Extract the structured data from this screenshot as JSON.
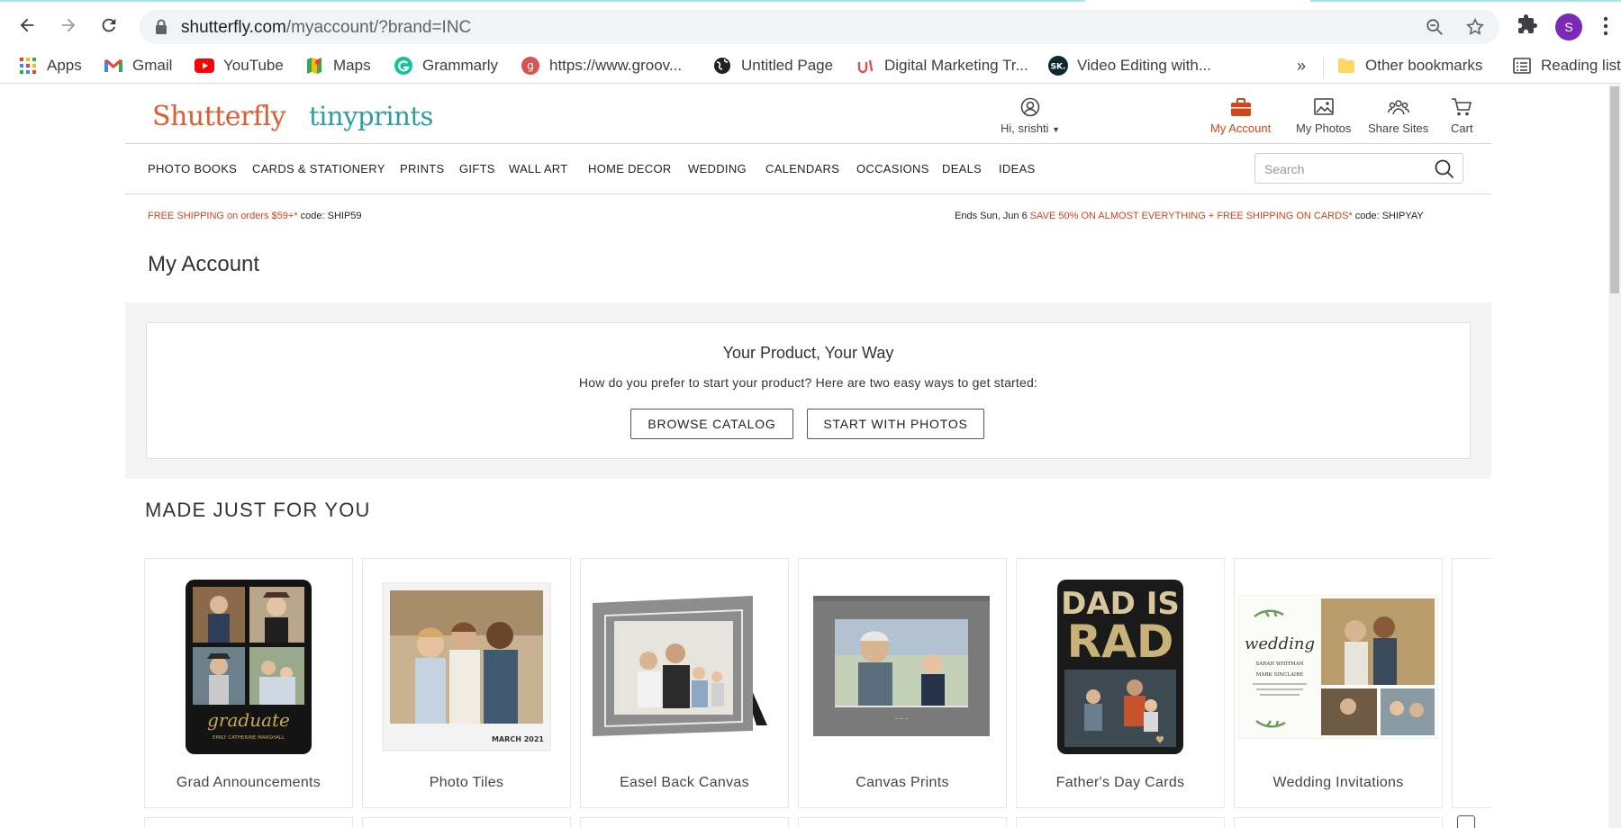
{
  "browser": {
    "url_host": "shutterfly.com",
    "url_path": "/myaccount/?brand=INC",
    "profile_initial": "S",
    "bookmarks": [
      {
        "label": "Apps",
        "icon": "apps-grid-icon"
      },
      {
        "label": "Gmail",
        "icon": "gmail-icon"
      },
      {
        "label": "YouTube",
        "icon": "youtube-icon"
      },
      {
        "label": "Maps",
        "icon": "maps-icon"
      },
      {
        "label": "Grammarly",
        "icon": "grammarly-icon"
      },
      {
        "label": "https://www.groov...",
        "icon": "groove-icon"
      },
      {
        "label": "Untitled Page",
        "icon": "globe-icon"
      },
      {
        "label": "Digital Marketing Tr...",
        "icon": "udemy-icon"
      },
      {
        "label": "Video Editing with...",
        "icon": "sk-icon"
      }
    ],
    "overflow": "»",
    "other_bookmarks": "Other bookmarks",
    "reading_list": "Reading list"
  },
  "site": {
    "logo_primary": "Shutterfly",
    "logo_secondary": "tinyprints",
    "utility": {
      "greeting": "Hi, srishti",
      "my_account": "My Account",
      "my_photos": "My Photos",
      "share_sites": "Share Sites",
      "cart": "Cart"
    },
    "categories": [
      "PHOTO BOOKS",
      "CARDS & STATIONERY",
      "PRINTS",
      "GIFTS",
      "WALL ART",
      "HOME DECOR",
      "WEDDING",
      "CALENDARS",
      "OCCASIONS",
      "DEALS",
      "IDEAS"
    ],
    "search_placeholder": "Search",
    "promo_left_highlight": "FREE SHIPPING on orders $59+*",
    "promo_left_code": " code: SHIP59",
    "promo_right_prefix": "Ends Sun, Jun 6 ",
    "promo_right_highlight": "SAVE 50% ON ALMOST EVERYTHING + FREE SHIPPING ON CARDS*",
    "promo_right_code": " code: SHIPYAY"
  },
  "main": {
    "page_title": "My Account",
    "card_title": "Your Product, Your Way",
    "card_subtitle": "How do you prefer to start your product? Here are two easy ways to get started:",
    "browse_button": "BROWSE CATALOG",
    "photos_button": "START WITH PHOTOS",
    "section_title": "MADE JUST FOR YOU",
    "tiles": [
      {
        "label": "Grad Announcements",
        "caption": "graduate",
        "name_line": "EMILY CATHERINE MARSHALL"
      },
      {
        "label": "Photo Tiles",
        "caption": "MARCH 2021"
      },
      {
        "label": "Easel Back Canvas"
      },
      {
        "label": "Canvas Prints"
      },
      {
        "label": "Father's Day Cards",
        "caption_line1": "DAD IS",
        "caption_line2": "RAD"
      },
      {
        "label": "Wedding Invitations",
        "caption": "wedding",
        "names": "SARAH WHITMAN",
        "names2": "MARK SINCLAIRE"
      }
    ]
  },
  "colors": {
    "accent": "#d1461b",
    "teal": "#2c9fa3",
    "profile": "#7b2ab8"
  }
}
